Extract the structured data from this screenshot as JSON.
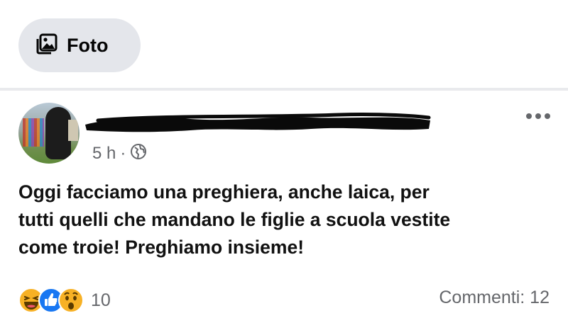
{
  "composer": {
    "photo_label": "Foto",
    "photo_icon": "photo-icon"
  },
  "post": {
    "author_name_redacted": true,
    "time": "5 h",
    "separator": "·",
    "privacy_icon": "globe-icon",
    "more_icon": "more-horizontal-icon",
    "text": "Oggi facciamo una preghiera, anche laica, per\ntutti quelli che mandano le figlie a scuola vestite\ncome troie! Preghiamo insieme!"
  },
  "footer": {
    "reaction_icons": [
      "haha-icon",
      "like-icon",
      "wow-icon"
    ],
    "reaction_count": "10",
    "comments": "Commenti: 12"
  },
  "colors": {
    "secondary_text": "#65676b",
    "chip_bg": "#e4e6eb",
    "like_blue": "#1877f2",
    "reaction_yellow": "#f7b125"
  }
}
